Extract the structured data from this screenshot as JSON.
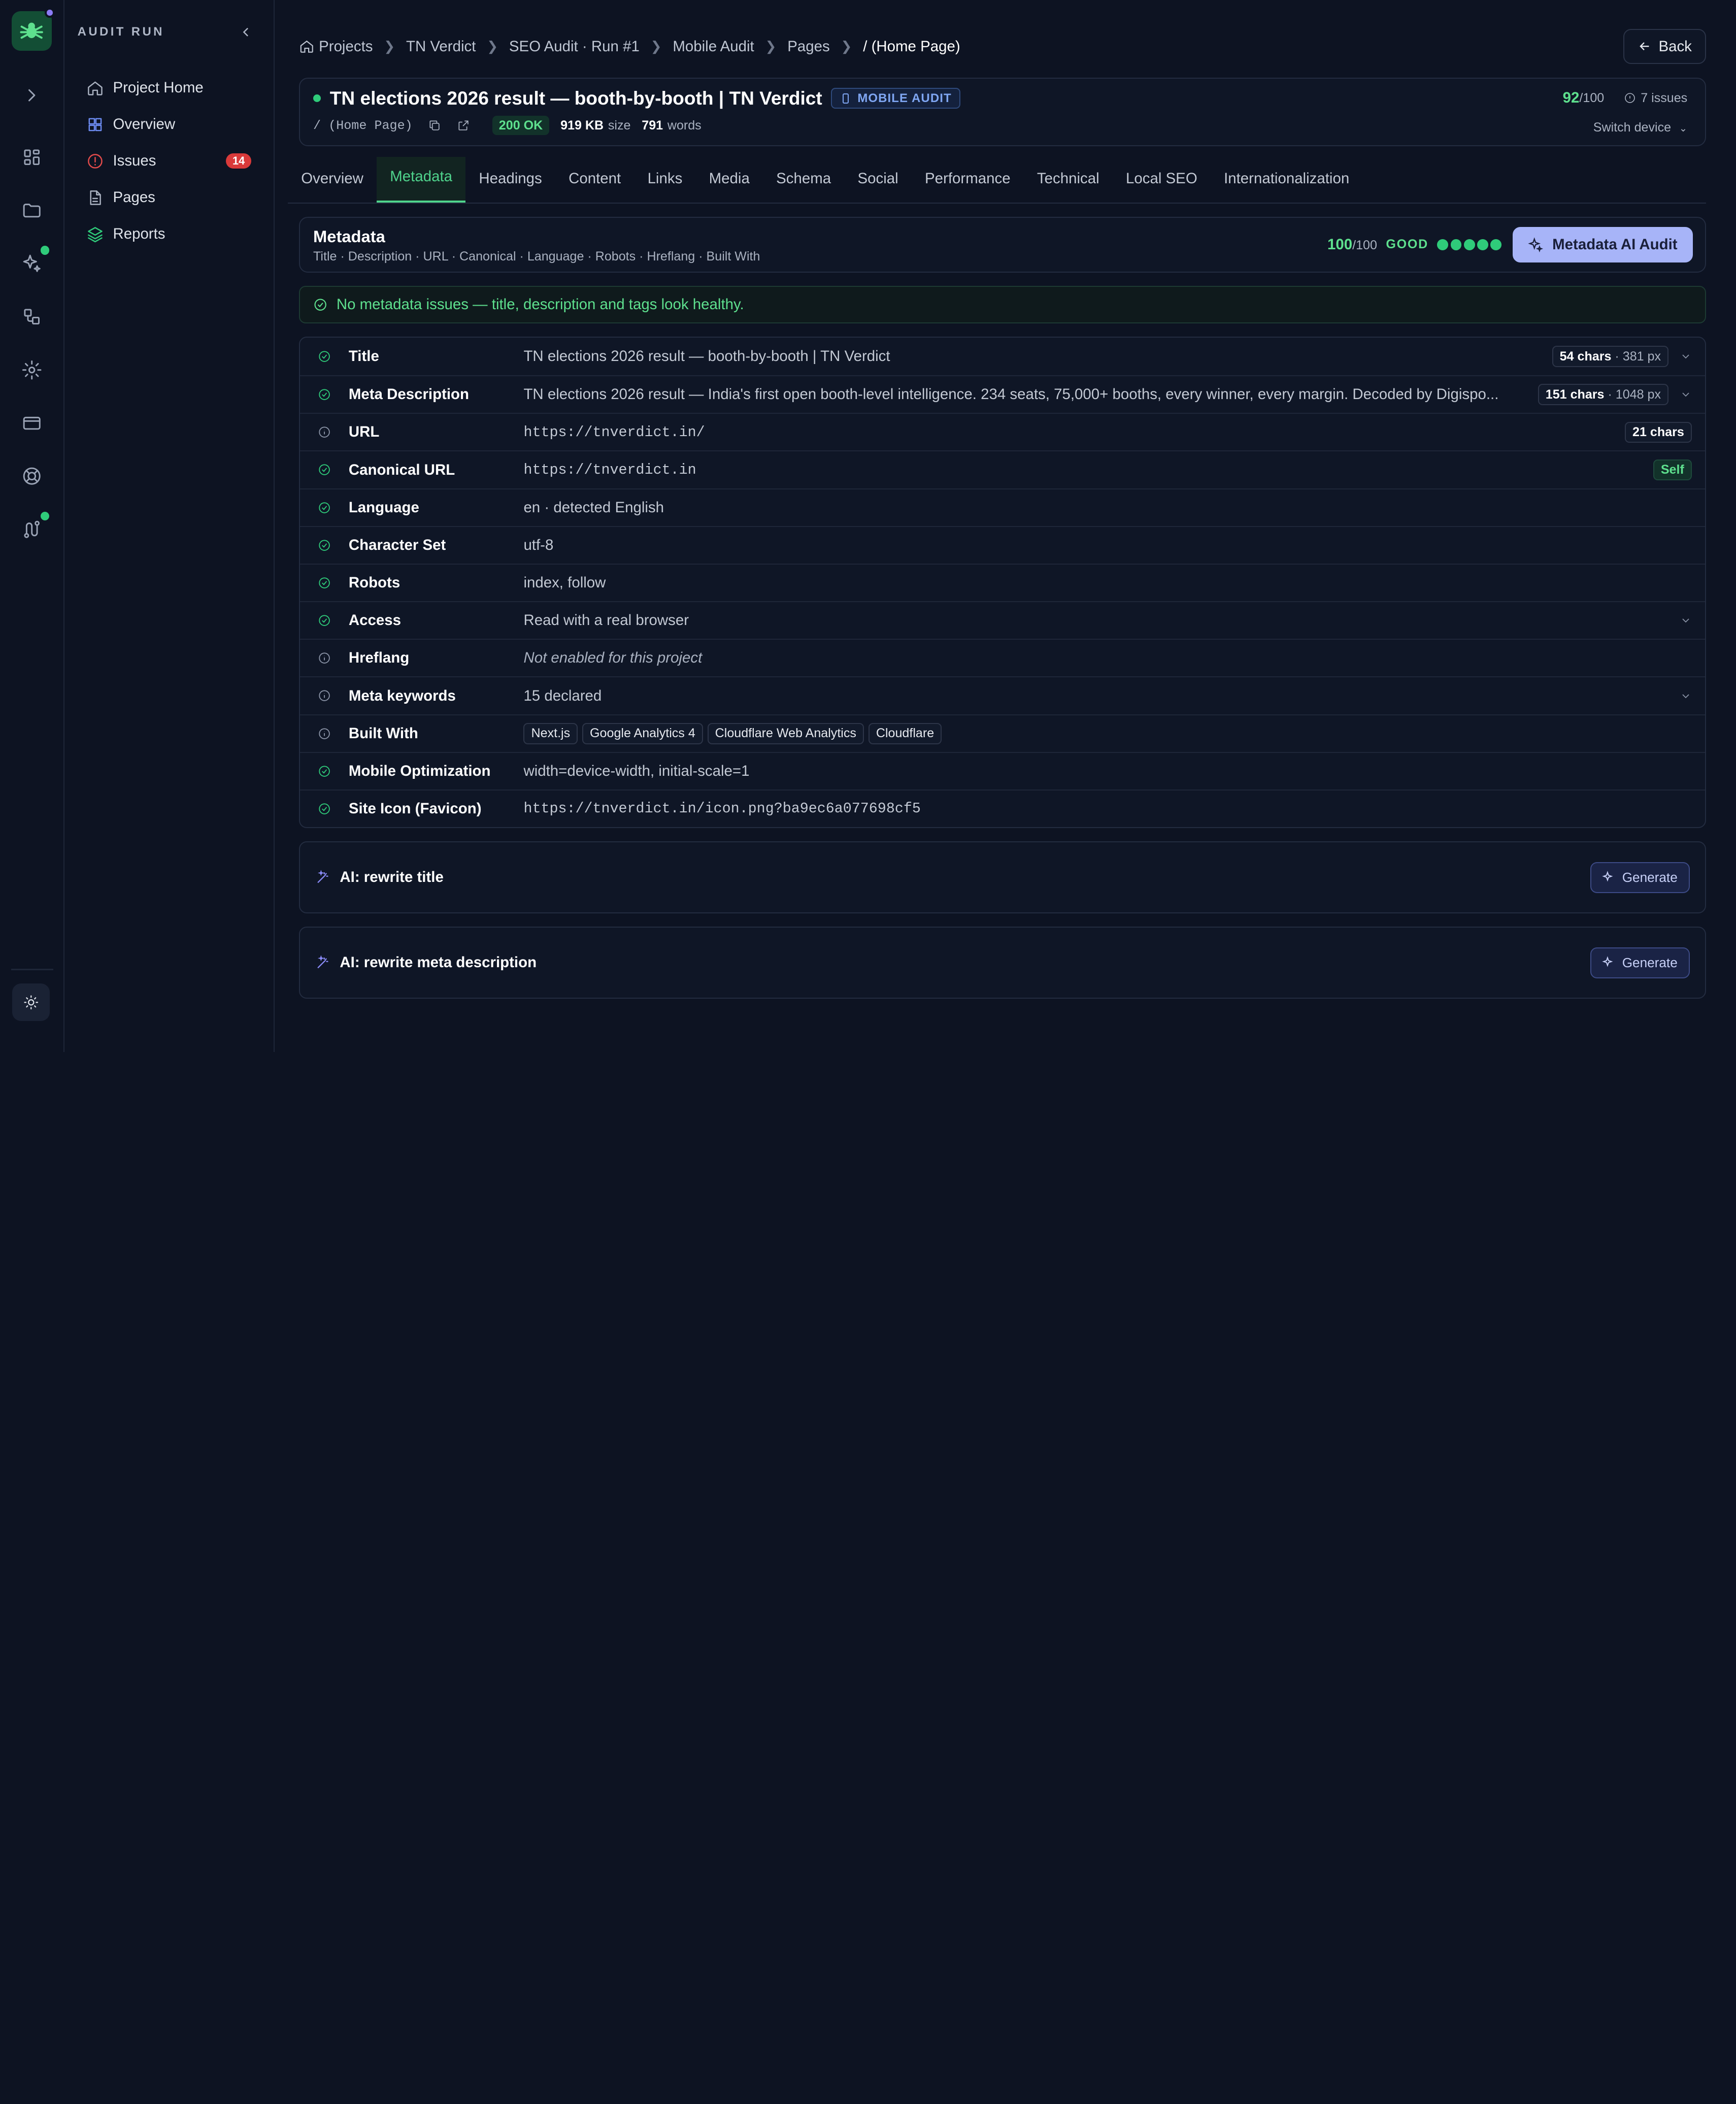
{
  "sidebar": {
    "title": "AUDIT RUN",
    "items": [
      {
        "label": "Project Home"
      },
      {
        "label": "Overview"
      },
      {
        "label": "Issues",
        "badge": "14"
      },
      {
        "label": "Pages"
      },
      {
        "label": "Reports"
      }
    ]
  },
  "breadcrumb": [
    "Projects",
    "TN Verdict",
    "SEO Audit · Run #1",
    "Mobile Audit",
    "Pages",
    "/ (Home Page)"
  ],
  "back_label": "Back",
  "page": {
    "title": "TN elections 2026 result — booth-by-booth | TN Verdict",
    "badge": "MOBILE AUDIT",
    "path": "/ (Home Page)",
    "status": "200 OK",
    "size_value": "919 KB",
    "size_label": "size",
    "words_value": "791",
    "words_label": "words",
    "score": "92",
    "score_max": "/100",
    "issues": "7 issues",
    "switch_device": "Switch device"
  },
  "tabs": [
    "Overview",
    "Metadata",
    "Headings",
    "Content",
    "Links",
    "Media",
    "Schema",
    "Social",
    "Performance",
    "Technical",
    "Local SEO",
    "Internationalization"
  ],
  "section": {
    "title": "Metadata",
    "subtitle": "Title · Description · URL · Canonical · Language · Robots · Hreflang · Built With",
    "score": "100",
    "score_max": "/100",
    "grade": "GOOD",
    "ai_button": "Metadata AI Audit"
  },
  "notice": "No metadata issues — title, description and tags look healthy.",
  "rows": [
    {
      "label": "Title",
      "value": "TN elections 2026 result — booth-by-booth | TN Verdict",
      "chars": "54 chars",
      "px": "381 px",
      "status": "ok"
    },
    {
      "label": "Meta Description",
      "value": "TN elections 2026 result — India's first open booth-level intelligence. 234 seats, 75,000+ booths, every winner, every margin. Decoded by Digispo...",
      "chars": "151 chars",
      "px": "1048 px",
      "status": "ok"
    },
    {
      "label": "URL",
      "value": "https://tnverdict.in/",
      "chars": "21 chars",
      "status": "info"
    },
    {
      "label": "Canonical URL",
      "value": "https://tnverdict.in",
      "tag": "Self",
      "status": "ok"
    },
    {
      "label": "Language",
      "value": "en · detected English",
      "status": "ok"
    },
    {
      "label": "Character Set",
      "value": "utf-8",
      "status": "ok"
    },
    {
      "label": "Robots",
      "value": "index, follow",
      "status": "ok"
    },
    {
      "label": "Access",
      "value": "Read with a real browser",
      "status": "ok"
    },
    {
      "label": "Hreflang",
      "value": "Not enabled for this project",
      "status": "info"
    },
    {
      "label": "Meta keywords",
      "value": "15 declared",
      "status": "info"
    },
    {
      "label": "Built With",
      "tech": [
        "Next.js",
        "Google Analytics 4",
        "Cloudflare Web Analytics",
        "Cloudflare"
      ],
      "status": "info"
    },
    {
      "label": "Mobile Optimization",
      "value": "width=device-width, initial-scale=1",
      "status": "ok"
    },
    {
      "label": "Site Icon (Favicon)",
      "value": "https://tnverdict.in/icon.png?ba9ec6a077698cf5",
      "status": "ok"
    }
  ],
  "ai_cards": [
    {
      "title": "AI: rewrite title",
      "button": "Generate"
    },
    {
      "title": "AI: rewrite meta description",
      "button": "Generate"
    }
  ],
  "colors": {
    "accent_green": "#2fcb7a",
    "danger": "#d93a3a",
    "ai_purple": "#a7b4f8"
  }
}
